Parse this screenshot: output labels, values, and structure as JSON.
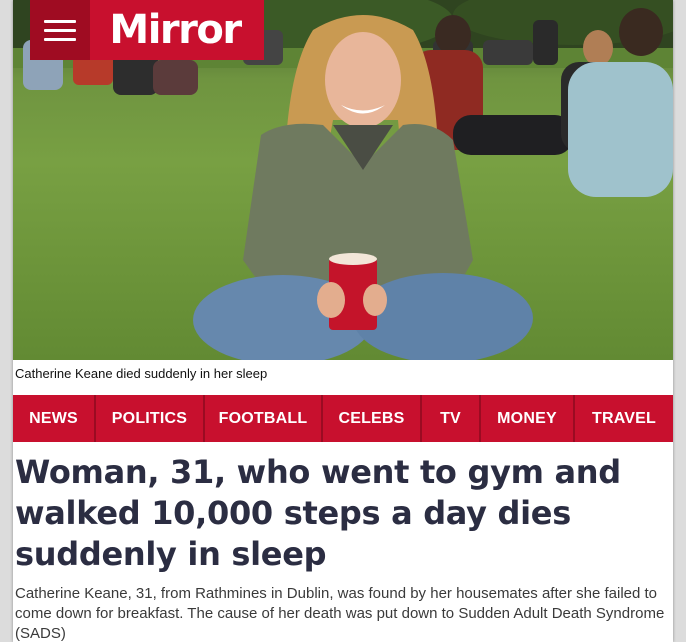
{
  "brand": {
    "name": "Mirror",
    "color": "#c8102e"
  },
  "header": {
    "menu_icon": "hamburger-menu-icon"
  },
  "photo": {
    "caption": "Catherine Keane died suddenly in her sleep"
  },
  "nav": {
    "items": [
      {
        "label": "NEWS"
      },
      {
        "label": "POLITICS"
      },
      {
        "label": "FOOTBALL"
      },
      {
        "label": "CELEBS"
      },
      {
        "label": "TV"
      },
      {
        "label": "MONEY"
      },
      {
        "label": "TRAVEL"
      }
    ]
  },
  "article": {
    "headline": "Woman, 31, who went to gym and walked 10,000 steps a day dies suddenly in sleep",
    "standfirst": "Catherine Keane, 31, from Rathmines in Dublin, was found by her housemates after she failed to come down for breakfast. The cause of her death was put down to Sudden Adult Death Syndrome (SADS)"
  }
}
